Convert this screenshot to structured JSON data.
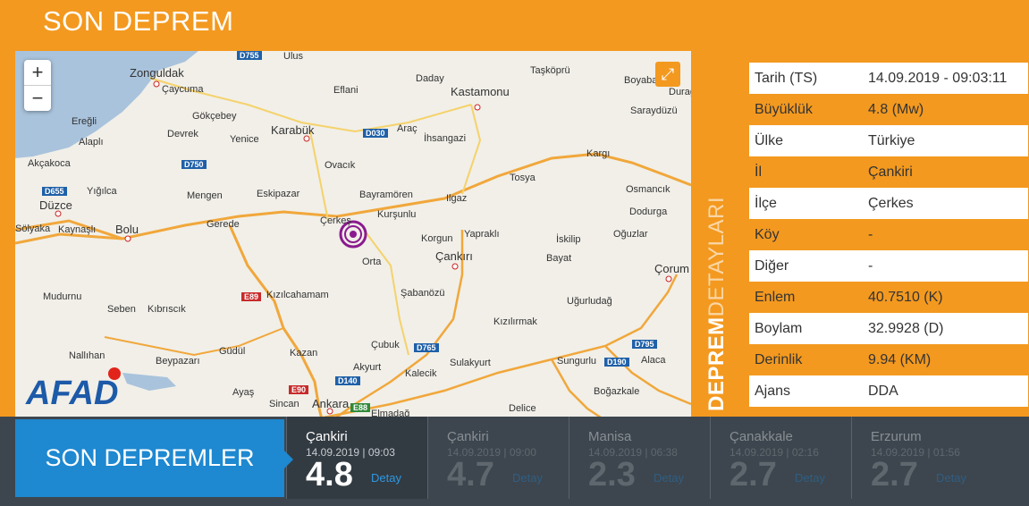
{
  "page": {
    "title": "SON DEPREM"
  },
  "map": {
    "zoom_in": "+",
    "zoom_out": "−",
    "fullscreen_icon": "expand-icon",
    "logo": "AFAD",
    "labels": [
      "Zonguldak",
      "Ulus",
      "Daday",
      "Taşköprü",
      "Boyabat",
      "Çaycuma",
      "Eflani",
      "Kastamonu",
      "Saraydüzü",
      "Durağan",
      "Gökçebey",
      "Karabük",
      "Araç",
      "İhsangazi",
      "Ereğli",
      "Devrek",
      "Yenice",
      "Alaplı",
      "Akçakoca",
      "Ovacık",
      "Kargı",
      "Yığılca",
      "Mengen",
      "Eskipazar",
      "Bayramören",
      "Ilgaz",
      "Tosya",
      "Osmancık",
      "Düzce",
      "Gerede",
      "Çerkeş",
      "Kurşunlu",
      "Dodurga",
      "Sölyaka",
      "Kaynaşlı",
      "Bolu",
      "Korgun",
      "Yapraklı",
      "İskilip",
      "Oğuzlar",
      "Orta",
      "Çankırı",
      "Bayat",
      "Çorum",
      "Mudurnu",
      "Kızılcahamam",
      "Şabanözü",
      "Uğurludağ",
      "Seben",
      "Kıbrıscık",
      "Kızılırmak",
      "Nallıhan",
      "Beypazarı",
      "Güdül",
      "Kazan",
      "Çubuk",
      "Sulakyurt",
      "Sungurlu",
      "Alaca",
      "Ayaş",
      "Sincan",
      "Ankara",
      "Akyurt",
      "Kalecik",
      "Boğazkale",
      "Elmadağ",
      "Delice"
    ],
    "roads": [
      "D755",
      "D030",
      "D750",
      "D655",
      "E89",
      "D765",
      "D795",
      "D190",
      "D140",
      "E90",
      "E88"
    ]
  },
  "side_title": {
    "bold": "DEPREM",
    "light": "DETAYLARI"
  },
  "details": [
    {
      "key": "Tarih (TS)",
      "value": "14.09.2019 - 09:03:11"
    },
    {
      "key": "Büyüklük",
      "value": "4.8 (Mw)"
    },
    {
      "key": "Ülke",
      "value": "Türkiye"
    },
    {
      "key": "İl",
      "value": "Çankiri"
    },
    {
      "key": "İlçe",
      "value": "Çerkes"
    },
    {
      "key": "Köy",
      "value": "-"
    },
    {
      "key": "Diğer",
      "value": "-"
    },
    {
      "key": "Enlem",
      "value": "40.7510 (K)"
    },
    {
      "key": "Boylam",
      "value": "32.9928 (D)"
    },
    {
      "key": "Derinlik",
      "value": "9.94 (KM)"
    },
    {
      "key": "Ajans",
      "value": "DDA"
    }
  ],
  "recent": {
    "title": "SON DEPREMLER",
    "items": [
      {
        "city": "Çankiri",
        "time": "14.09.2019 | 09:03",
        "mag": "4.8",
        "detail": "Detay"
      },
      {
        "city": "Çankiri",
        "time": "14.09.2019 | 09:00",
        "mag": "4.7",
        "detail": "Detay"
      },
      {
        "city": "Manisa",
        "time": "14.09.2019 | 06:38",
        "mag": "2.3",
        "detail": "Detay"
      },
      {
        "city": "Çanakkale",
        "time": "14.09.2019 | 02:16",
        "mag": "2.7",
        "detail": "Detay"
      },
      {
        "city": "Erzurum",
        "time": "14.09.2019 | 01:56",
        "mag": "2.7",
        "detail": "Detay"
      }
    ]
  },
  "colors": {
    "accent": "#f3991f",
    "blue": "#1e88d0",
    "dark": "#3d464e",
    "quake": "#8b1a8f"
  }
}
